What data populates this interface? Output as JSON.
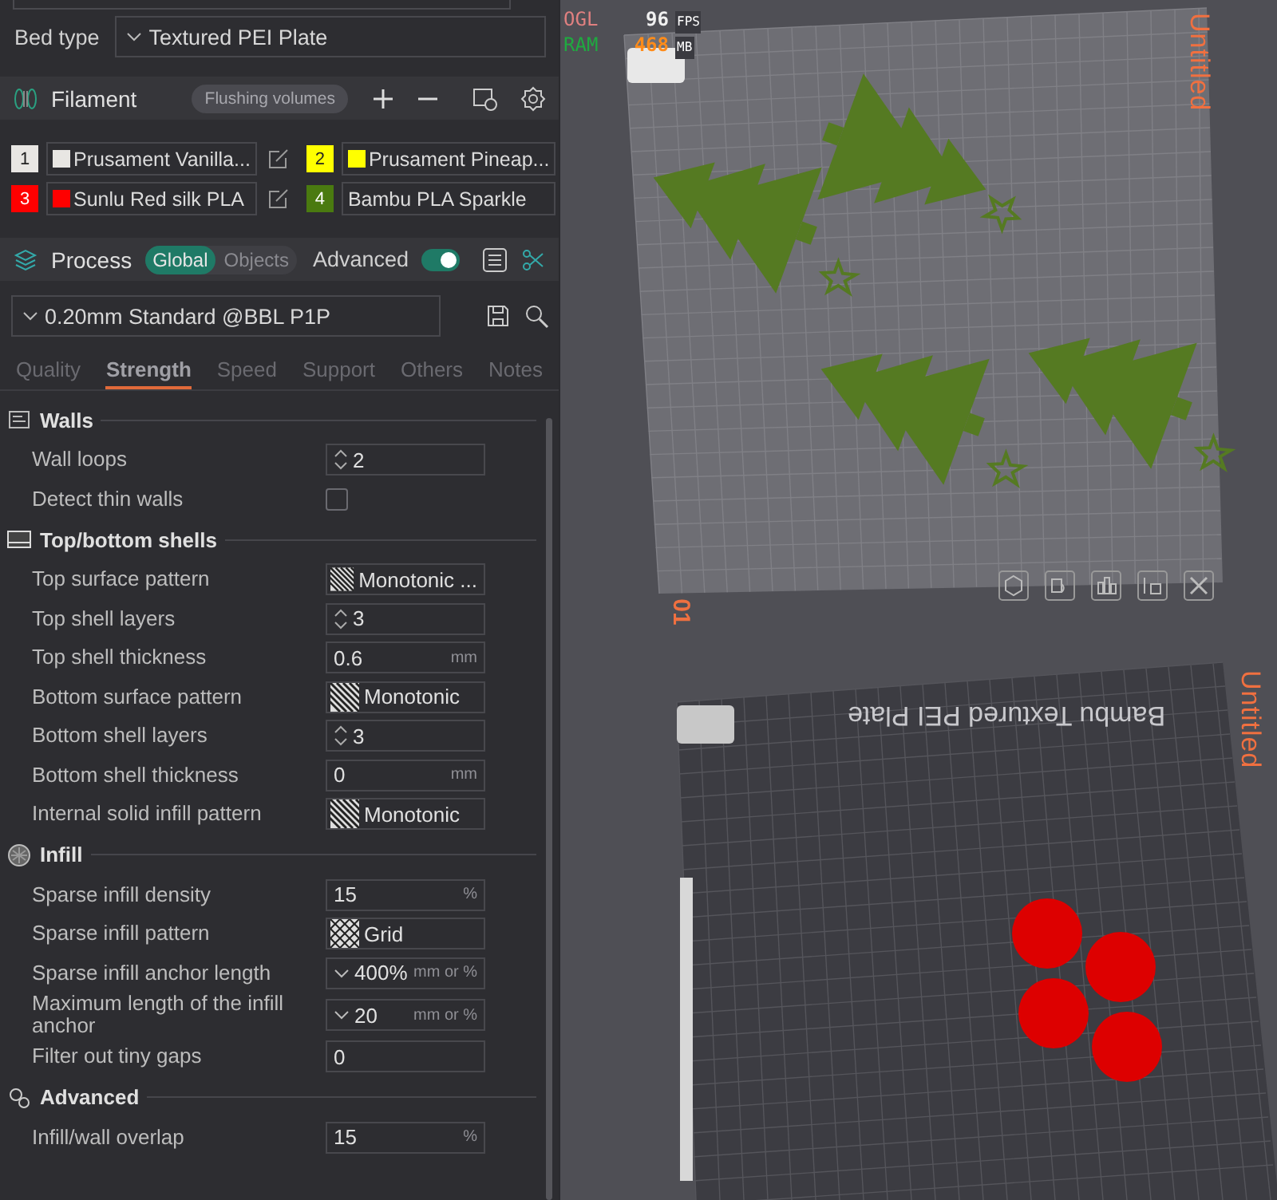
{
  "bed_type": {
    "label": "Bed type",
    "value": "Textured PEI Plate"
  },
  "filament": {
    "title": "Filament",
    "flushing_button": "Flushing volumes",
    "slots": [
      {
        "number": "1",
        "name": "Prusament Vanilla...",
        "color": "#e8e6e3",
        "swatch": true
      },
      {
        "number": "2",
        "name": "Prusament Pineap...",
        "color": "#ffff00",
        "swatch": true
      },
      {
        "number": "3",
        "name": "Sunlu Red silk PLA",
        "color": "#ff0000",
        "swatch": true
      },
      {
        "number": "4",
        "name": "Bambu PLA Sparkle",
        "color": "#4a7a10",
        "swatch": false
      }
    ]
  },
  "process": {
    "title": "Process",
    "scope_tabs": [
      {
        "label": "Global",
        "selected": true
      },
      {
        "label": "Objects",
        "selected": false
      }
    ],
    "advanced": {
      "label": "Advanced",
      "on": true
    },
    "preset": "0.20mm Standard @BBL P1P",
    "tabs": [
      {
        "label": "Quality",
        "selected": false
      },
      {
        "label": "Strength",
        "selected": true
      },
      {
        "label": "Speed",
        "selected": false
      },
      {
        "label": "Support",
        "selected": false
      },
      {
        "label": "Others",
        "selected": false
      },
      {
        "label": "Notes",
        "selected": false
      }
    ]
  },
  "sections": [
    {
      "title": "Walls",
      "rows": [
        {
          "kind": "spin",
          "label": "Wall loops",
          "value": "2"
        },
        {
          "kind": "checkbox",
          "label": "Detect thin walls",
          "checked": false
        }
      ]
    },
    {
      "title": "Top/bottom shells",
      "rows": [
        {
          "kind": "hatch",
          "label": "Top surface pattern",
          "value": "Monotonic ..."
        },
        {
          "kind": "spin",
          "label": "Top shell layers",
          "value": "3"
        },
        {
          "kind": "unit",
          "label": "Top shell thickness",
          "value": "0.6",
          "unit": "mm"
        },
        {
          "kind": "hatch",
          "label": "Bottom surface pattern",
          "value": "Monotonic"
        },
        {
          "kind": "spin",
          "label": "Bottom shell layers",
          "value": "3"
        },
        {
          "kind": "unit",
          "label": "Bottom shell thickness",
          "value": "0",
          "unit": "mm"
        },
        {
          "kind": "hatch",
          "label": "Internal solid infill pattern",
          "value": "Monotonic"
        }
      ]
    },
    {
      "title": "Infill",
      "rows": [
        {
          "kind": "unit",
          "label": "Sparse infill density",
          "value": "15",
          "unit": "%"
        },
        {
          "kind": "crosshatch",
          "label": "Sparse infill pattern",
          "value": "Grid"
        },
        {
          "kind": "combo",
          "label": "Sparse infill anchor length",
          "value": "400%",
          "unit": "mm or %"
        },
        {
          "kind": "combo",
          "label": "Maximum length of the infill anchor",
          "value": "20",
          "unit": "mm or %"
        },
        {
          "kind": "text",
          "label": "Filter out tiny gaps",
          "value": "0"
        }
      ]
    },
    {
      "title": "Advanced",
      "rows": [
        {
          "kind": "unit",
          "label": "Infill/wall overlap",
          "value": "15",
          "unit": "%"
        }
      ]
    }
  ],
  "viewport": {
    "stats": [
      {
        "name": "OGL",
        "value": "96",
        "unit": "FPS"
      },
      {
        "name": "RAM",
        "value": "468",
        "unit": "MB"
      }
    ],
    "plates": [
      {
        "number": "01",
        "name": "Untitled"
      },
      {
        "name": "Untitled",
        "bed_label": "Bambu Textured PEI Plate"
      }
    ]
  }
}
